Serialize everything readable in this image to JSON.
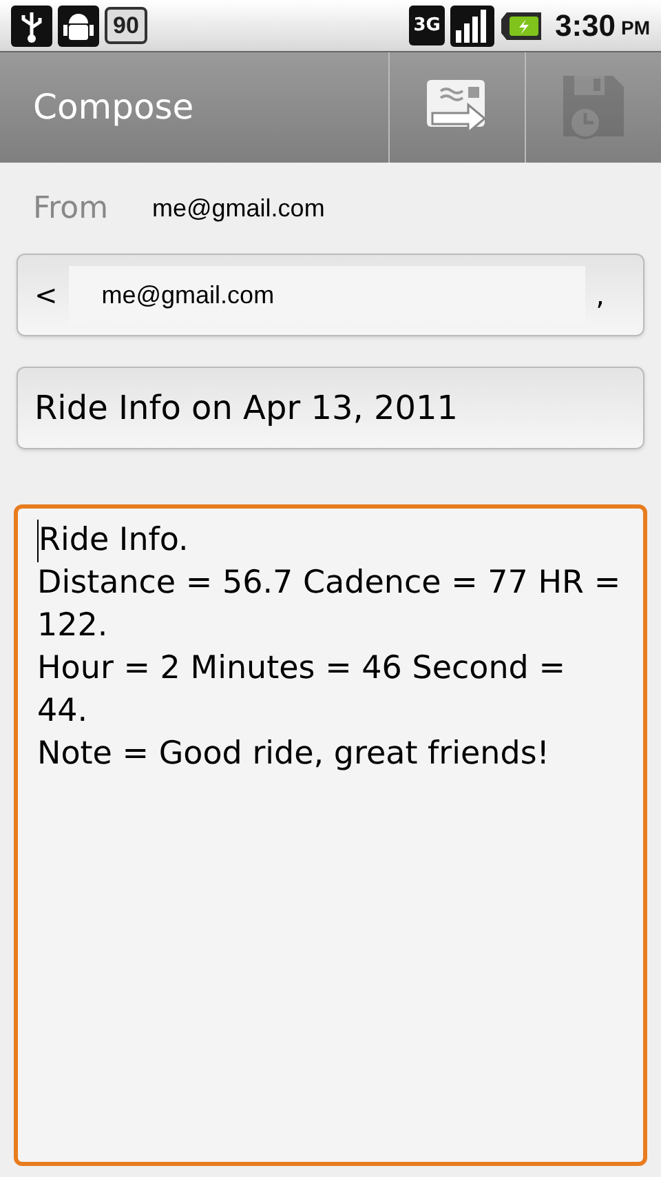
{
  "status_bar": {
    "battery_badge": "90",
    "network": "3G",
    "time": "3:30",
    "am_pm": "PM"
  },
  "action_bar": {
    "title": "Compose",
    "buttons": [
      {
        "kind": "send",
        "disabled": false
      },
      {
        "kind": "save_draft",
        "disabled": true
      }
    ]
  },
  "from": {
    "label": "From",
    "value": "me@gmail.com"
  },
  "to": {
    "open": "<",
    "recipient": "me@gmail.com",
    "separator": ","
  },
  "subject": {
    "value": "Ride Info on Apr 13, 2011"
  },
  "body": {
    "focused": true,
    "lines": [
      "Ride Info.",
      "Distance = 56.7 Cadence = 77 HR =",
      "122.",
      "Hour = 2 Minutes = 46 Second =",
      "44.",
      "Note = Good ride, great friends!"
    ]
  }
}
